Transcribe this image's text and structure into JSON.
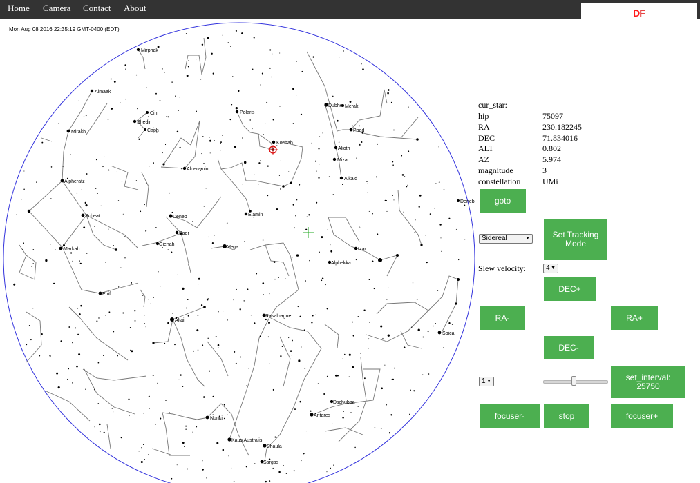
{
  "nav": {
    "items": [
      "Home",
      "Camera",
      "Contact",
      "About"
    ],
    "logo_text": "DF",
    "logo_color_d": "#ff1a1a",
    "logo_color_f": "#e84545"
  },
  "timestamp": "Mon Aug 08 2016 22:35:19 GMT-0400 (EDT)",
  "star_labels": [
    "Mirphak",
    "Almaak",
    "Cih",
    "Shedir",
    "Caph",
    "Mirach",
    "Polaris",
    "Kochab",
    "Dubhe",
    "Merak",
    "Phad",
    "Alioth",
    "Mizar",
    "Alkaid",
    "Alderamin",
    "Alpheratz",
    "Deneb",
    "Scheat",
    "Deneb",
    "Elamin",
    "Sadr",
    "Gienah",
    "Vega",
    "Markab",
    "Izar",
    "Alphekka",
    "Enif",
    "Rasalhague",
    "Altair",
    "Spica",
    "Dschubba",
    "Antares",
    "Nunki",
    "Kaus Australis",
    "Shaula",
    "Sargas"
  ],
  "info": {
    "cur_star_label": "cur_star:",
    "rows": [
      {
        "key": "hip",
        "value": "75097"
      },
      {
        "key": "RA",
        "value": "230.182245"
      },
      {
        "key": "DEC",
        "value": "71.834016"
      },
      {
        "key": "ALT",
        "value": "0.802"
      },
      {
        "key": "AZ",
        "value": "5.974"
      },
      {
        "key": "magnitude",
        "value": "3"
      },
      {
        "key": "constellation",
        "value": "UMi"
      }
    ]
  },
  "controls": {
    "goto": "goto",
    "tracking_mode_value": "Sidereal",
    "set_tracking_mode": "Set Tracking Mode",
    "slew_velocity_label": "Slew velocity:",
    "slew_velocity_value": "4",
    "dec_plus": "DEC+",
    "ra_minus": "RA-",
    "ra_plus": "RA+",
    "dec_minus": "DEC-",
    "interval_select_value": "1",
    "set_interval": "set_interval: 25750",
    "interval_slider_fraction": 0.48,
    "focuser_minus": "focuser-",
    "stop": "stop",
    "focuser_plus": "focuser+"
  },
  "colors": {
    "navbar": "#333333",
    "button": "#4caf50",
    "horizon_circle": "#3333dd",
    "crosshair": "#22aa22",
    "selected_star_marker": "#dd1111"
  }
}
